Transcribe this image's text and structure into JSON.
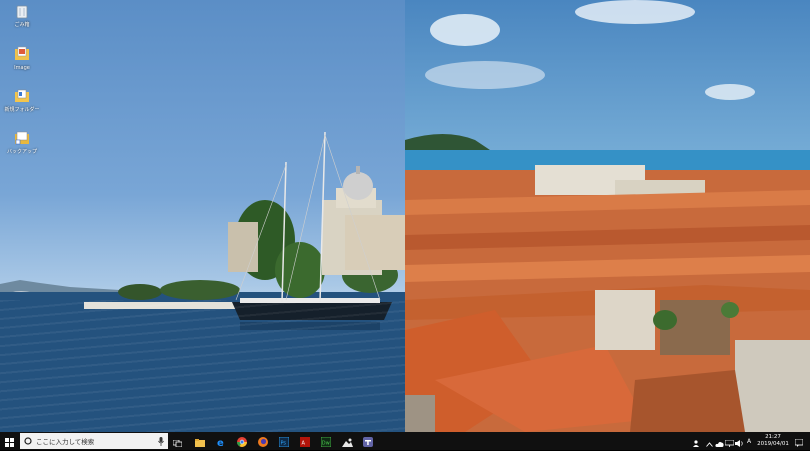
{
  "desktop": {
    "icons": [
      {
        "label": "ごみ箱",
        "icon": "recycle-bin-icon"
      },
      {
        "label": "Image",
        "icon": "image-folder-icon"
      },
      {
        "label": "新規フォルダー",
        "icon": "folder-icon"
      },
      {
        "label": "バックアップ",
        "icon": "folder-shortcut-icon"
      }
    ]
  },
  "taskbar": {
    "search_placeholder": "ここに入力して検索",
    "apps": [
      "task-view-icon",
      "file-explorer-icon",
      "edge-icon",
      "chrome-icon",
      "firefox-icon",
      "photoshop-icon",
      "acrobat-icon",
      "dreamweaver-icon",
      "photos-icon",
      "teams-icon"
    ]
  },
  "tray": {
    "time": "21:27",
    "date": "2019/04/01"
  },
  "colors": {
    "taskbar": "#101010",
    "accent": "#0078d7"
  }
}
